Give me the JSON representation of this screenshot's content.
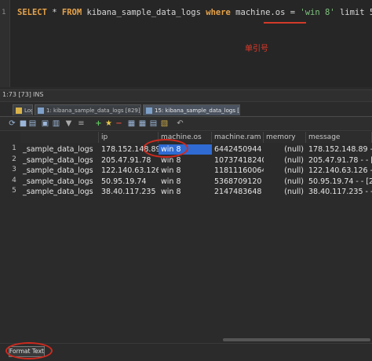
{
  "editor": {
    "line_number": "1",
    "sql": {
      "kw_select": "SELECT",
      "star": " * ",
      "kw_from": "FROM",
      "table": " kibana_sample_data_logs ",
      "kw_where": "where",
      "cond": " machine.os = ",
      "value": "'win 8'",
      "limit": " limit 5"
    },
    "annotation": "单引号"
  },
  "status": {
    "position": "1:73 [73]",
    "mode": "INS"
  },
  "tabs": [
    {
      "label": "Log"
    },
    {
      "label": "1: kibana_sample_data_logs [829]*"
    },
    {
      "label": "15: kibana_sample_data_logs [5]"
    }
  ],
  "toolbar": {
    "icons": [
      "refresh-icon",
      "stop-icon",
      "export-icon",
      "filter-icon",
      "sort-icon",
      "add-icon",
      "star-icon",
      "delete-icon",
      "grid-icon",
      "form-icon",
      "text-icon",
      "undo-icon"
    ]
  },
  "grid": {
    "columns": [
      "",
      "ip",
      "machine.os",
      "machine.ram",
      "memory",
      "message"
    ],
    "rows": [
      {
        "num": "1",
        "index": "_sample_data_logs",
        "ip": "178.152.148.89",
        "os": "win 8",
        "ram": "6442450944",
        "memory": "(null)",
        "message": "178.152.148.89 - - ["
      },
      {
        "num": "2",
        "index": "_sample_data_logs",
        "ip": "205.47.91.78",
        "os": "win 8",
        "ram": "10737418240",
        "memory": "(null)",
        "message": "205.47.91.78 - - [20"
      },
      {
        "num": "3",
        "index": "_sample_data_logs",
        "ip": "122.140.63.126",
        "os": "win 8",
        "ram": "11811160064",
        "memory": "(null)",
        "message": "122.140.63.126 - - ["
      },
      {
        "num": "4",
        "index": "_sample_data_logs",
        "ip": "50.95.19.74",
        "os": "win 8",
        "ram": "5368709120",
        "memory": "(null)",
        "message": "50.95.19.74 - - [201"
      },
      {
        "num": "5",
        "index": "_sample_data_logs",
        "ip": "38.40.117.235",
        "os": "win 8",
        "ram": "2147483648",
        "memory": "(null)",
        "message": "38.40.117.235 - - [2"
      }
    ]
  },
  "footer": {
    "format_text": "Format Text"
  }
}
